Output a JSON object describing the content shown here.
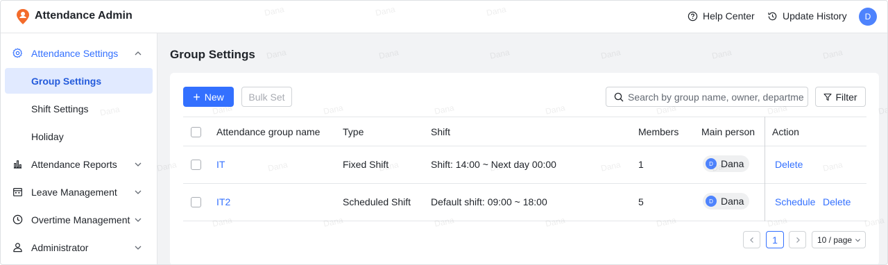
{
  "header": {
    "app_title": "Attendance Admin",
    "help_label": "Help Center",
    "history_label": "Update History",
    "avatar_initial": "D"
  },
  "sidebar": {
    "items": [
      {
        "label": "Attendance Settings",
        "icon": "gear-icon",
        "state": "expanded"
      },
      {
        "label": "Group Settings",
        "state": "selected"
      },
      {
        "label": "Shift Settings"
      },
      {
        "label": "Holiday"
      },
      {
        "label": "Attendance Reports",
        "icon": "bar-chart-icon"
      },
      {
        "label": "Leave Management",
        "icon": "calendar-icon"
      },
      {
        "label": "Overtime Management",
        "icon": "clock-icon"
      },
      {
        "label": "Administrator",
        "icon": "user-icon"
      }
    ]
  },
  "main": {
    "page_title": "Group Settings",
    "toolbar": {
      "new_label": "New",
      "bulk_label": "Bulk Set",
      "search_placeholder": "Search by group name, owner, departme...",
      "filter_label": "Filter"
    },
    "table": {
      "columns": [
        "Attendance group name",
        "Type",
        "Shift",
        "Members",
        "Main person",
        "Action"
      ],
      "rows": [
        {
          "name": "IT",
          "type": "Fixed Shift",
          "shift": "Shift: 14:00 ~ Next day 00:00",
          "members": "1",
          "person": "Dana",
          "person_initial": "D",
          "actions": [
            "Delete"
          ]
        },
        {
          "name": "IT2",
          "type": "Scheduled Shift",
          "shift": "Default shift: 09:00 ~ 18:00",
          "members": "5",
          "person": "Dana",
          "person_initial": "D",
          "actions": [
            "Schedule",
            "Delete"
          ]
        }
      ]
    },
    "pagination": {
      "current_page": "1",
      "page_size": "10 / page"
    }
  },
  "watermark": "Dana",
  "colors": {
    "accent": "#3370ff",
    "selected_bg": "#e1eaff",
    "logo": "#f36b2b"
  }
}
